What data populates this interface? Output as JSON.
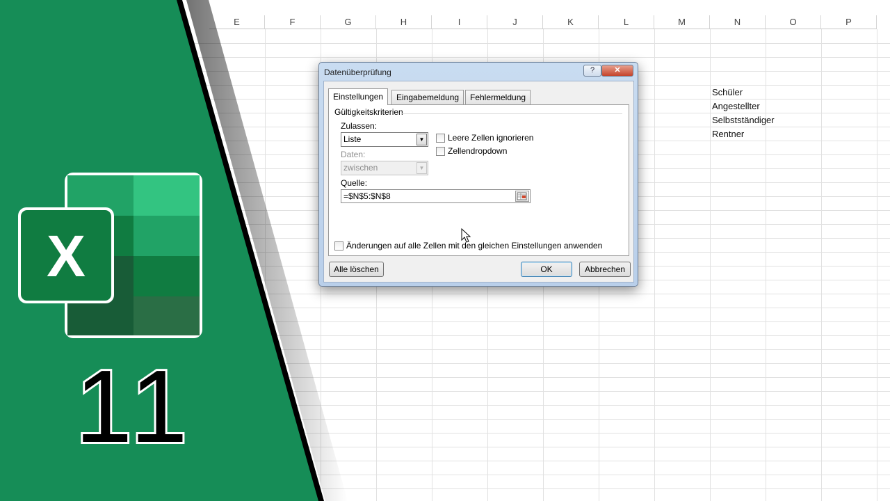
{
  "sheet": {
    "columns": [
      "E",
      "F",
      "G",
      "H",
      "I",
      "J",
      "K",
      "L",
      "M",
      "N",
      "O",
      "P"
    ],
    "cells": {
      "n5": "Schüler",
      "n6": "Angestellter",
      "n7": "Selbstständiger",
      "n8": "Rentner"
    }
  },
  "overlay": {
    "episode_number": "11",
    "logo": "excel-logo",
    "colors": {
      "green": "#168d57"
    }
  },
  "dialog": {
    "title": "Datenüberprüfung",
    "help_label": "?",
    "close_label": "✕",
    "tabs": [
      "Einstellungen",
      "Eingabemeldung",
      "Fehlermeldung"
    ],
    "group_label": "Gültigkeitskriterien",
    "allow_label": "Zulassen:",
    "allow_value": "Liste",
    "data_label": "Daten:",
    "data_value": "zwischen",
    "ignore_blank_label": "Leere Zellen ignorieren",
    "ignore_blank_checked": false,
    "dropdown_label": "Zellendropdown",
    "dropdown_checked": false,
    "source_label": "Quelle:",
    "source_value": "=$N$5:$N$8",
    "apply_all_label": "Änderungen auf alle Zellen mit den gleichen Einstellungen anwenden",
    "apply_all_checked": false,
    "clear_all_label": "Alle löschen",
    "ok_label": "OK",
    "cancel_label": "Abbrechen"
  }
}
